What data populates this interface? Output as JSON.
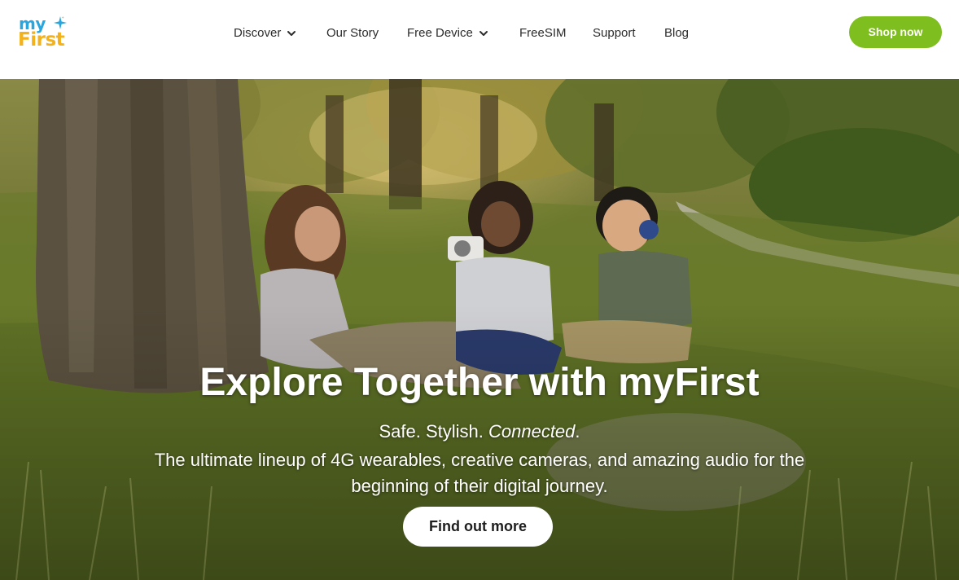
{
  "brand": {
    "logo_top": "my",
    "logo_bottom": "First",
    "logo_colors": {
      "my": "#2aa6de",
      "first": "#f3b21c",
      "sparkle": "#2aa6de"
    }
  },
  "nav": {
    "items": [
      {
        "label": "Discover",
        "has_dropdown": true,
        "icon": "chevron-down-icon"
      },
      {
        "label": "Our Story",
        "has_dropdown": false
      },
      {
        "label": "Free Device",
        "has_dropdown": true,
        "icon": "chevron-down-icon"
      },
      {
        "label": "FreeSIM",
        "has_dropdown": false
      },
      {
        "label": "Support",
        "has_dropdown": false
      },
      {
        "label": "Blog",
        "has_dropdown": false
      }
    ],
    "cta_label": "Shop now",
    "cta_color": "#7ebe1e"
  },
  "hero": {
    "title": "Explore Together with myFirst",
    "tagline_plain": "Safe. Stylish. ",
    "tagline_emphasis": "Connected",
    "tagline_end": ".",
    "description": "The ultimate lineup of 4G wearables, creative cameras, and amazing audio for the beginning of their digital journey.",
    "button_label": "Find out more"
  }
}
